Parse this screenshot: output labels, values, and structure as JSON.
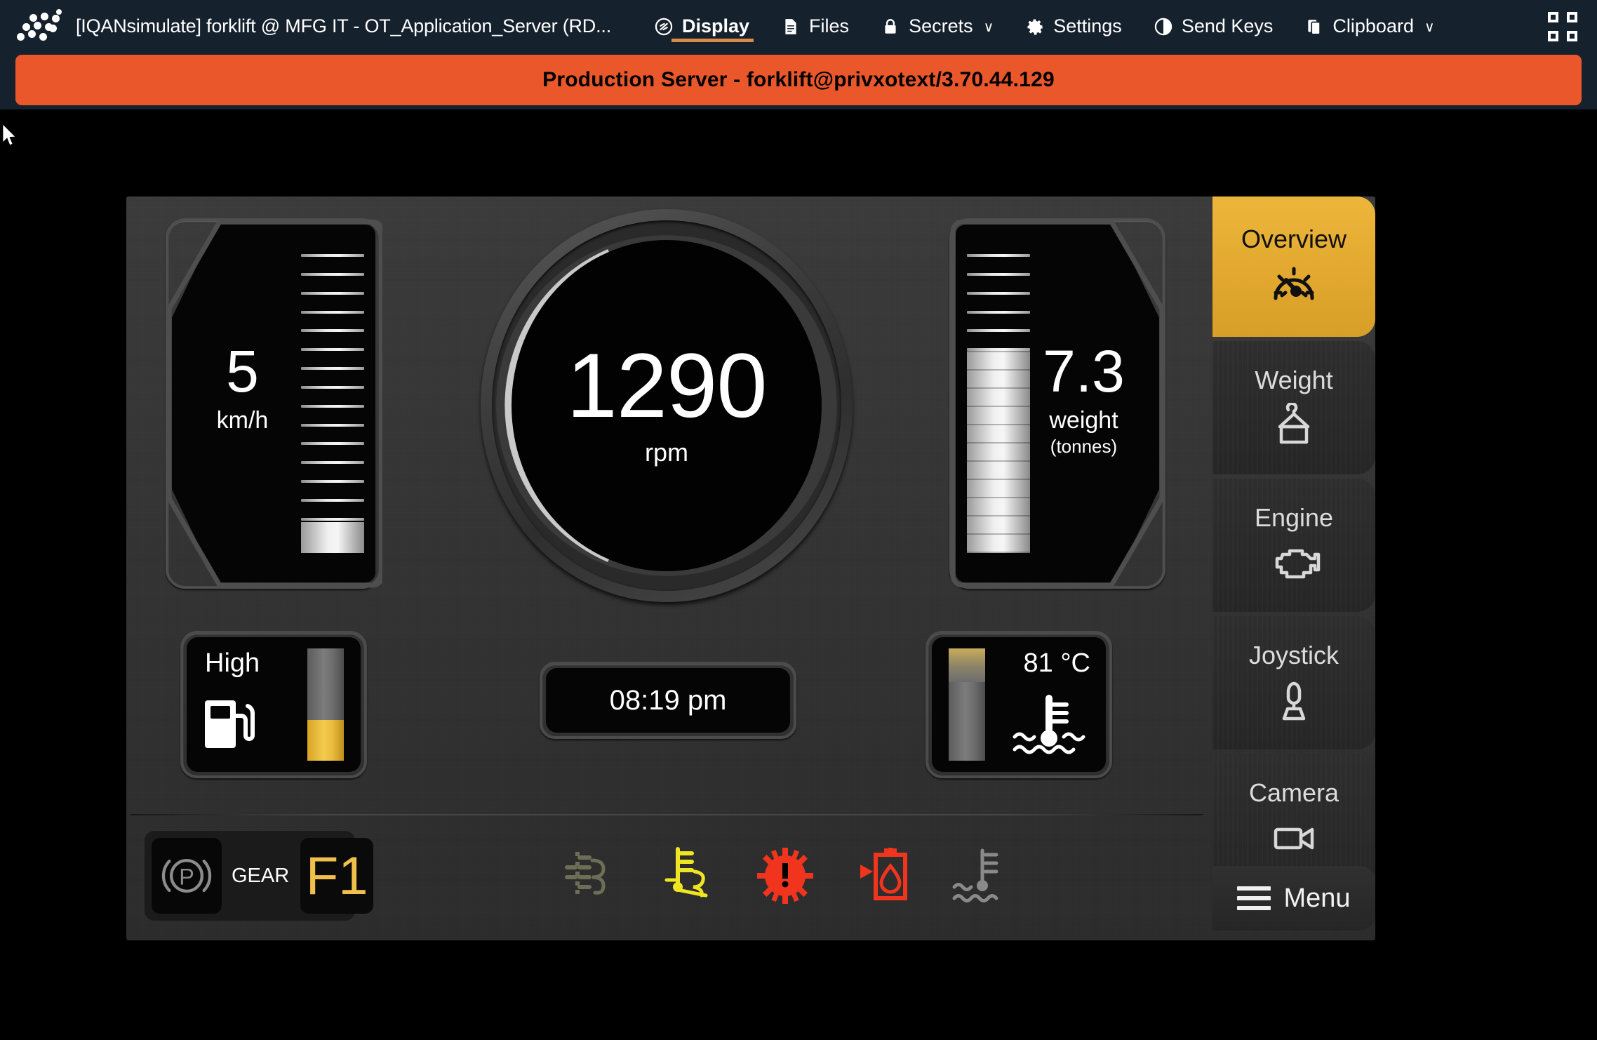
{
  "chrome": {
    "logo_name": "privx-dots-logo",
    "window_title": "[IQANsimulate] forklift @ MFG IT - OT_Application_Server (RD...",
    "menu": [
      {
        "label": "Display",
        "icon": "display-icon",
        "active": true,
        "caret": ""
      },
      {
        "label": "Files",
        "icon": "file-icon",
        "active": false,
        "caret": ""
      },
      {
        "label": "Secrets",
        "icon": "lock-icon",
        "active": false,
        "caret": "∨"
      },
      {
        "label": "Settings",
        "icon": "gear-icon",
        "active": false,
        "caret": ""
      },
      {
        "label": "Send Keys",
        "icon": "send-keys-icon",
        "active": false,
        "caret": ""
      },
      {
        "label": "Clipboard",
        "icon": "clipboard-icon",
        "active": false,
        "caret": "∨"
      }
    ],
    "expand_icon": "fullscreen-icon"
  },
  "banner": {
    "text": "Production Server - forklift@privxotext/3.70.44.129",
    "background": "#e9572b",
    "text_color": "#000000"
  },
  "dashboard": {
    "speed": {
      "value": "5",
      "unit": "km/h",
      "fill_percent": 10,
      "ticks": 15
    },
    "rpm": {
      "value": "1290",
      "unit": "rpm",
      "arc_color": "#c9c9c9",
      "track_color": "#3a3a3a"
    },
    "weight": {
      "value": "7.3",
      "unit": "weight",
      "sub": "(tonnes)",
      "fill_percent": 62,
      "ticks": 15
    },
    "fuel": {
      "level_label": "High",
      "icon": "fuel-pump-icon",
      "bar_amber_percent": 36
    },
    "clock": {
      "time": "08:19 pm"
    },
    "temperature": {
      "value": "81 °C",
      "icon": "coolant-temp-icon",
      "bar_amber_percent": 30
    },
    "status": {
      "park_brake_icon": "park-brake-icon",
      "gear_label": "GEAR",
      "gear_value": "F1",
      "gear_color": "#f0c04a",
      "telltales": [
        {
          "name": "glow-plug-preheat-icon",
          "color": "#6e6e57",
          "state": "off"
        },
        {
          "name": "engine-preheat-icon",
          "color": "#efe522",
          "state": "on"
        },
        {
          "name": "engine-warning-gear-icon",
          "color": "#f0341d",
          "state": "on"
        },
        {
          "name": "hydraulic-fluid-warning-icon",
          "color": "#f0341d",
          "state": "on"
        },
        {
          "name": "coolant-temperature-icon",
          "color": "#8a8a8a",
          "state": "off"
        }
      ]
    }
  },
  "sidebar": {
    "tabs": [
      {
        "label": "Overview",
        "icon": "speedometer-icon",
        "active": true
      },
      {
        "label": "Weight",
        "icon": "crane-hook-icon",
        "active": false
      },
      {
        "label": "Engine",
        "icon": "engine-block-icon",
        "active": false
      },
      {
        "label": "Joystick",
        "icon": "joystick-icon",
        "active": false
      },
      {
        "label": "Camera",
        "icon": "video-camera-icon",
        "active": false
      }
    ],
    "menu_button": {
      "label": "Menu",
      "icon": "hamburger-icon"
    },
    "active_color": "#e2a82f"
  }
}
